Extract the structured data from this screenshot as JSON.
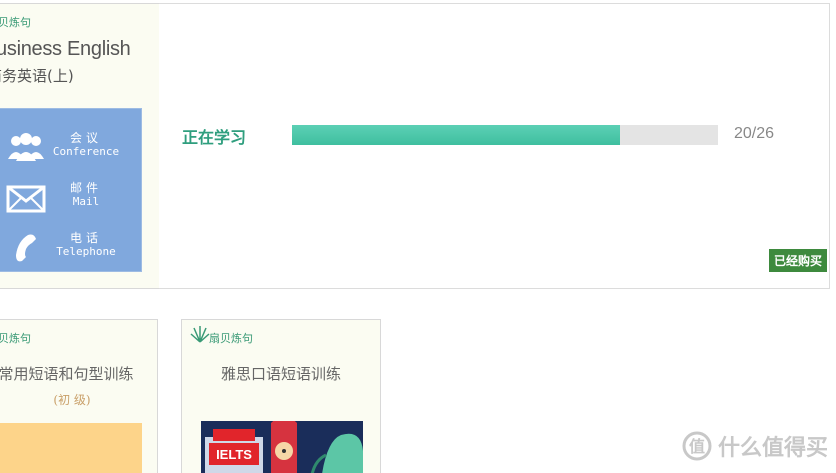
{
  "top_course": {
    "brand": "扇贝炼句",
    "title_en": "Business English",
    "title_cn": "商务英语(上)",
    "topics": [
      {
        "icon": "people-icon",
        "label_cn": "会议",
        "label_en": "Conference"
      },
      {
        "icon": "mail-icon",
        "label_cn": "邮件",
        "label_en": "Mail"
      },
      {
        "icon": "phone-icon",
        "label_cn": "电话",
        "label_en": "Telephone"
      }
    ]
  },
  "progress": {
    "label": "正在学习",
    "current": 20,
    "total": 26,
    "fraction": 0.7692,
    "count_text": "20/26",
    "purchased_label": "已经购买",
    "accent_color": "#3fbf9f"
  },
  "cards": [
    {
      "brand": "扇贝炼句",
      "title": "常用短语和句型训练",
      "level": "(初 级)"
    },
    {
      "brand": "扇贝炼句",
      "title": "雅思口语短语训练",
      "badge_text": "IELTS"
    }
  ],
  "watermark": {
    "text": "什么值得买",
    "logo": "value-logo-icon"
  }
}
